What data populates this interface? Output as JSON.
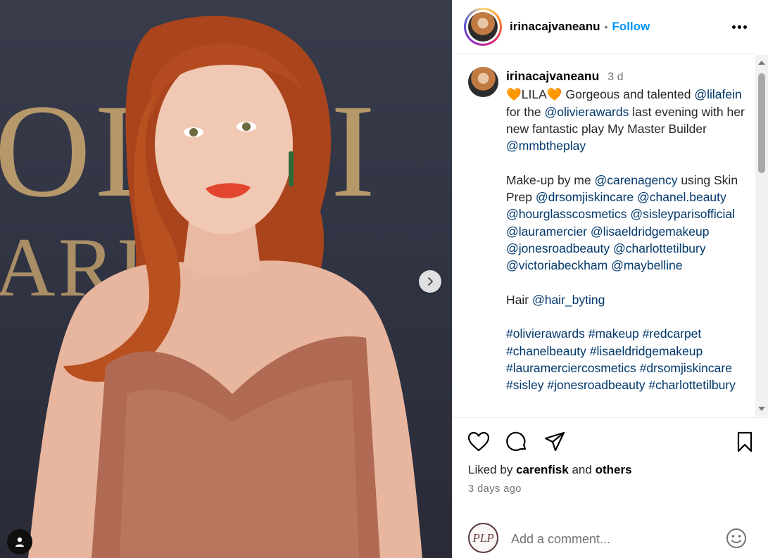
{
  "media": {
    "background_text_line1": "OLIVI",
    "background_text_line2": "ARD",
    "next_icon": "chevron-right-icon",
    "tag_icon": "person-tag-icon"
  },
  "post": {
    "username": "irinacajvaneanu",
    "separator": "•",
    "follow_label": "Follow",
    "more_icon": "ellipsis-icon"
  },
  "caption": {
    "username": "irinacajvaneanu",
    "time": "3 d",
    "segments": [
      [
        {
          "t": "🧡",
          "h": 1
        },
        {
          "t": "LILA"
        },
        {
          "t": "🧡",
          "h": 1
        },
        {
          "t": " Gorgeous and talented "
        },
        {
          "t": "@lilafein",
          "m": 1
        },
        {
          "t": " for the "
        },
        {
          "t": "@olivierawards",
          "m": 1
        },
        {
          "t": " last evening with her new fantastic play My Master Builder "
        },
        {
          "t": "@mmbtheplay",
          "m": 1
        }
      ],
      [],
      [
        {
          "t": "Make-up by me "
        },
        {
          "t": "@carenagency",
          "m": 1
        },
        {
          "t": " using Skin Prep "
        },
        {
          "t": "@drsomjiskincare",
          "m": 1
        },
        {
          "t": " "
        },
        {
          "t": "@chanel.beauty",
          "m": 1
        },
        {
          "t": " "
        },
        {
          "t": "@hourglasscosmetics",
          "m": 1
        },
        {
          "t": " "
        },
        {
          "t": "@sisleyparisofficial",
          "m": 1
        },
        {
          "t": " "
        },
        {
          "t": "@lauramercier",
          "m": 1
        },
        {
          "t": " "
        },
        {
          "t": "@lisaeldridgemakeup",
          "m": 1
        },
        {
          "t": " "
        },
        {
          "t": "@jonesroadbeauty",
          "m": 1
        },
        {
          "t": " "
        },
        {
          "t": "@charlottetilbury",
          "m": 1
        },
        {
          "t": " "
        },
        {
          "t": "@victoriabeckham",
          "m": 1
        },
        {
          "t": " "
        },
        {
          "t": "@maybelline",
          "m": 1
        }
      ],
      [],
      [
        {
          "t": "Hair "
        },
        {
          "t": "@hair_byting",
          "m": 1
        }
      ],
      [],
      [
        {
          "t": "#olivierawards",
          "m": 1
        },
        {
          "t": " "
        },
        {
          "t": "#makeup",
          "m": 1
        },
        {
          "t": " "
        },
        {
          "t": "#redcarpet",
          "m": 1
        },
        {
          "t": " "
        },
        {
          "t": "#chanelbeauty",
          "m": 1
        },
        {
          "t": " "
        },
        {
          "t": "#lisaeldridgemakeup",
          "m": 1
        },
        {
          "t": " "
        },
        {
          "t": "#lauramerciercosmetics",
          "m": 1
        },
        {
          "t": " "
        },
        {
          "t": "#drsomjiskincare",
          "m": 1
        },
        {
          "t": " "
        },
        {
          "t": "#sisley",
          "m": 1
        },
        {
          "t": " "
        },
        {
          "t": "#jonesroadbeauty",
          "m": 1
        },
        {
          "t": " "
        },
        {
          "t": "#charlottetilbury",
          "m": 1
        }
      ]
    ]
  },
  "actions": {
    "like_icon": "heart-icon",
    "comment_icon": "comment-icon",
    "share_icon": "send-icon",
    "save_icon": "bookmark-icon"
  },
  "likes": {
    "prefix": "Liked by",
    "user": "carenfisk",
    "conjunction": "and",
    "others": "others"
  },
  "date": "3 days ago",
  "comment": {
    "avatar_text": "PLP",
    "placeholder": "Add a comment...",
    "emoji_icon": "smiley-icon"
  },
  "colors": {
    "link": "#0095f6",
    "mention": "#00376b",
    "muted": "#737373",
    "heart": "#f4701a"
  }
}
